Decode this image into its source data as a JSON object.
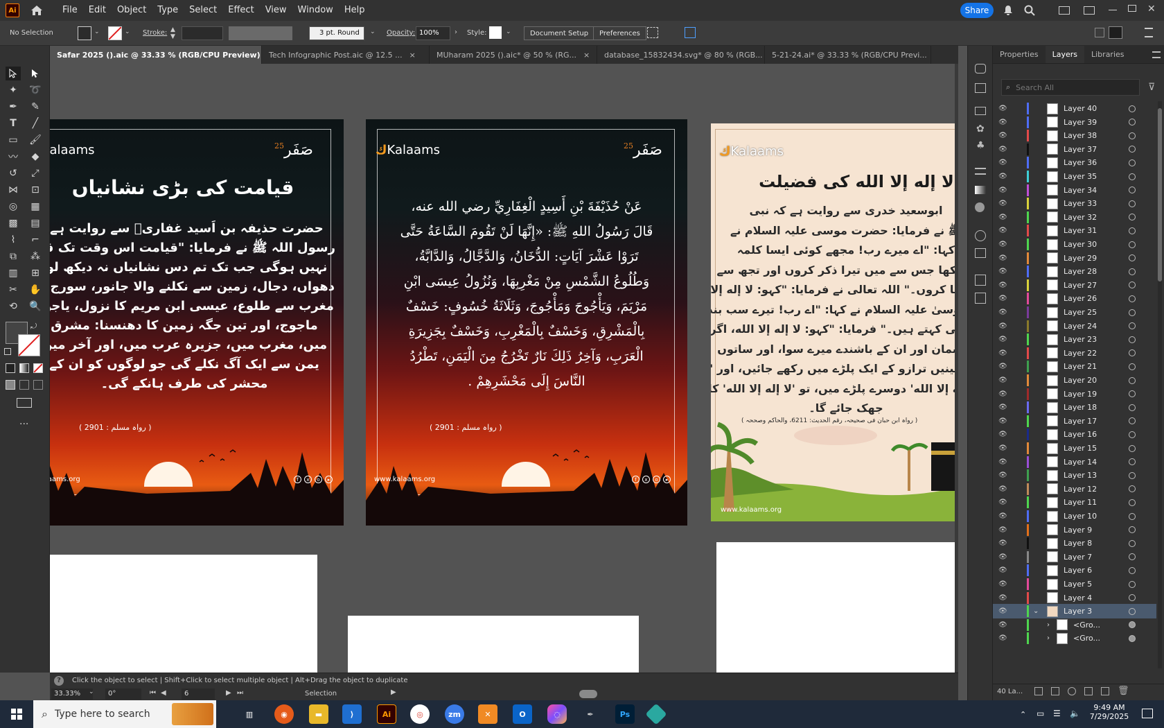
{
  "app": {
    "logo": "Ai",
    "home_icon": "home-icon"
  },
  "menu": [
    "File",
    "Edit",
    "Object",
    "Type",
    "Select",
    "Effect",
    "View",
    "Window",
    "Help"
  ],
  "share_label": "Share",
  "control": {
    "selection": "No Selection",
    "stroke_label": "Stroke:",
    "brush": "3 pt. Round",
    "opacity_label": "Opacity:",
    "opacity_value": "100%",
    "style_label": "Style:",
    "doc_setup": "Document Setup",
    "preferences": "Preferences"
  },
  "tabs": [
    {
      "label": "Safar 2025 ().aic @ 33.33 % (RGB/CPU Preview)",
      "close": "×"
    },
    {
      "label": "Tech Infographic Post.aic @ 12.5 ...",
      "close": "×"
    },
    {
      "label": "MUharam 2025 ().aic* @ 50 % (RG...",
      "close": "×"
    },
    {
      "label": "database_15832434.svg* @ 80 % (RGB...",
      "close": "×"
    },
    {
      "label": "5-21-24.ai* @ 33.33 % (RGB/CPU Previ...",
      "close": "×"
    }
  ],
  "artboard1": {
    "brand": "Kalaams",
    "safar": "صَفَر",
    "year": "25",
    "title": "قیامت کی بڑی نشانیاں",
    "lines": [
      "حضرت حذیفہ بن اَسید غفاریؓ سے روایت ہے،",
      "رسول اللہ ﷺ نے فرمایا: \"قیامت اس وقت تک قائم",
      "نہیں ہوگی جب تک تم دس نشانیاں نہ دیکھ لو:",
      "دھواں، دجال، زمین سے نکلنے والا جانور، سورج کا",
      "مغرب سے طلوع، عیسی ابن مریم کا نزول، یاجوج",
      "ماجوج، اور تین جگہ زمین کا دھنسنا: مشرق",
      "میں، مغرب میں، جزیرہ عرب میں، اور آخر میں",
      "یمن سے ایک آگ نکلے گی جو لوگوں کو ان کے",
      "محشر کی طرف ہانکے گی۔"
    ],
    "reference": "( رواہ مسلم : 2901 )",
    "site": "alaams.org"
  },
  "artboard2": {
    "brand": "Kalaams",
    "safar": "صَفَر",
    "year": "25",
    "lines": [
      "عَنْ حُذَيْفَةَ بْنِ أَسِيدٍ الْغِفَارِيِّ رضي الله عنه،",
      "قَالَ رَسُولُ اللهِ ﷺ: «إِنَّهَا لَنْ تَقُومَ السَّاعَةُ حَتَّى",
      "تَرَوْا عَشْرَ آيَاتٍ: الدُّخَانُ، وَالدَّجَّالُ، وَالدَّابَّةُ،",
      "وَطُلُوعُ الشَّمْسِ مِنْ مَغْرِبِهَا، وَنُزُولُ عِيسَى ابْنِ",
      "مَرْيَمَ، وَيَأْجُوجَ وَمَأْجُوجَ، وَثَلَاثَةُ خُسُوفٍ: خَسْفٌ",
      "بِالْمَشْرِقِ، وَخَسْفٌ بِالْمَغْرِبِ، وَخَسْفٌ بِجَزِيرَةِ",
      "الْعَرَبِ، وَآخِرُ ذَلِكَ نَارٌ تَخْرُجُ مِنَ الْيَمَنِ، تَطْرُدُ",
      "النَّاسَ إِلَى مَحْشَرِهِمْ ."
    ],
    "reference": "( رواہ مسلم : 2901 )",
    "site": "www.kalaams.org"
  },
  "artboard3": {
    "brand": "Kalaams",
    "title": "لا إله إلا الله کی فضیلت",
    "lines": [
      "ابوسعید خدری سے روایت ہے کہ نبی",
      "ﷺ نے فرمایا: حضرت موسی علیہ السلام نے",
      "کہا: \"اے میرے رب! مجھے کوئی ایسا کلمہ",
      "سکھا جس سے میں تیرا ذکر کروں اور تجھ سے",
      "دعا کروں۔\" اللہ تعالی نے فرمایا: \"کہو: لا إله إلا الله\"",
      "موسیٰ علیہ السلام نے کہا: \"اے رب! تیرے سب بندے",
      "یہی کہتے ہیں۔\" فرمایا: \"کہو: لا إله إلا الله، اگر ساتوں",
      "آسمان اور ان کے باشندے میرے سوا، اور ساتوں",
      "زمینیں ترازو کے ایک پلڑے میں رکھے جائیں، اور 'لا",
      "إله إلا الله' دوسرے پلڑے میں، تو 'لا إله إلا الله' کا پلڑا",
      "جھک جائے گا۔"
    ],
    "reference": "( رواہ ابن حبان فی صحیحہ، رقم الحدیث: 6211، والحاکم وصححہ )",
    "site": "www.kalaams.org"
  },
  "status": {
    "hint": "Click the object to select  |  Shift+Click to select multiple object  |  Alt+Drag the object to duplicate",
    "zoom": "33.33%",
    "rotation": "0°",
    "artboard_num": "6",
    "mode": "Selection"
  },
  "panel": {
    "tabs": [
      "Properties",
      "Layers",
      "Libraries"
    ],
    "search_placeholder": "Search All",
    "layer_count": "40 La...",
    "layers": [
      {
        "name": "Layer 40",
        "color": "#4f6df5"
      },
      {
        "name": "Layer 39",
        "color": "#4f6df5"
      },
      {
        "name": "Layer 38",
        "color": "#e34a4a"
      },
      {
        "name": "Layer 37",
        "color": "#111111"
      },
      {
        "name": "Layer 36",
        "color": "#4f6df5"
      },
      {
        "name": "Layer 35",
        "color": "#3ecfd6"
      },
      {
        "name": "Layer 34",
        "color": "#c04fd6"
      },
      {
        "name": "Layer 33",
        "color": "#d9d23b"
      },
      {
        "name": "Layer 32",
        "color": "#4fd64f"
      },
      {
        "name": "Layer 31",
        "color": "#e34a4a"
      },
      {
        "name": "Layer 30",
        "color": "#4fd64f"
      },
      {
        "name": "Layer 29",
        "color": "#e38a3a"
      },
      {
        "name": "Layer 28",
        "color": "#4f6df5"
      },
      {
        "name": "Layer 27",
        "color": "#d9d23b"
      },
      {
        "name": "Layer 26",
        "color": "#e34a9a"
      },
      {
        "name": "Layer 25",
        "color": "#7a3b9a"
      },
      {
        "name": "Layer 24",
        "color": "#8a7a2a"
      },
      {
        "name": "Layer 23",
        "color": "#4fd64f"
      },
      {
        "name": "Layer 22",
        "color": "#e34a4a"
      },
      {
        "name": "Layer 21",
        "color": "#3ea04f"
      },
      {
        "name": "Layer 20",
        "color": "#e38a3a"
      },
      {
        "name": "Layer 19",
        "color": "#a02a2a"
      },
      {
        "name": "Layer 18",
        "color": "#6a6af0"
      },
      {
        "name": "Layer 17",
        "color": "#4fd64f"
      },
      {
        "name": "Layer 16",
        "color": "#1a2a8a"
      },
      {
        "name": "Layer 15",
        "color": "#e38a3a"
      },
      {
        "name": "Layer 14",
        "color": "#9a4fd6"
      },
      {
        "name": "Layer 13",
        "color": "#3ea04f"
      },
      {
        "name": "Layer 12",
        "color": "#c08a5a"
      },
      {
        "name": "Layer 11",
        "color": "#4fd64f"
      },
      {
        "name": "Layer 10",
        "color": "#4f6df5"
      },
      {
        "name": "Layer 9",
        "color": "#e3701a"
      },
      {
        "name": "Layer 8",
        "color": "#111111"
      },
      {
        "name": "Layer 7",
        "color": "#888888"
      },
      {
        "name": "Layer 6",
        "color": "#4f6df5"
      },
      {
        "name": "Layer 5",
        "color": "#e34a9a"
      },
      {
        "name": "Layer 4",
        "color": "#e34a4a"
      },
      {
        "name": "Layer 3",
        "color": "#4fd64f",
        "selected": true
      },
      {
        "name": "<Gro...",
        "color": "#4fd64f"
      },
      {
        "name": "<Gro...",
        "color": "#4fd64f"
      }
    ]
  },
  "taskbar": {
    "search_placeholder": "Type here to search",
    "time": "9:49 AM",
    "date": "7/29/2025"
  }
}
